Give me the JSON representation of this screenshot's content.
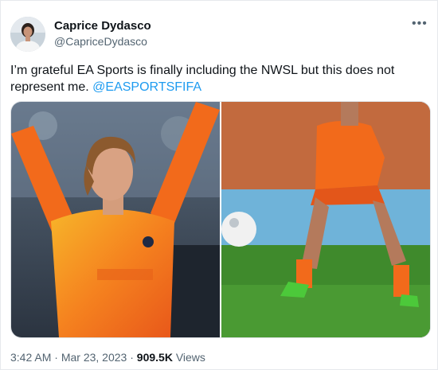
{
  "author": {
    "display_name": "Caprice Dydasco",
    "handle": "@CapriceDydasco"
  },
  "tweet": {
    "text": "I’m grateful EA Sports is finally including the NWSL but this does not represent me.",
    "mention": "@EASPORTSFIFA"
  },
  "media": {
    "left_image": "game-render-player-orange-kit",
    "right_image": "real-player-orange-kit-on-pitch"
  },
  "meta": {
    "time": "3:42 AM",
    "separator": "·",
    "date": "Mar 23, 2023",
    "views_count": "909.5K",
    "views_label": "Views"
  },
  "colors": {
    "link": "#1d9bf0",
    "muted": "#536471",
    "kit_orange": "#f26a1b",
    "pitch_green": "#3f8a2c"
  }
}
